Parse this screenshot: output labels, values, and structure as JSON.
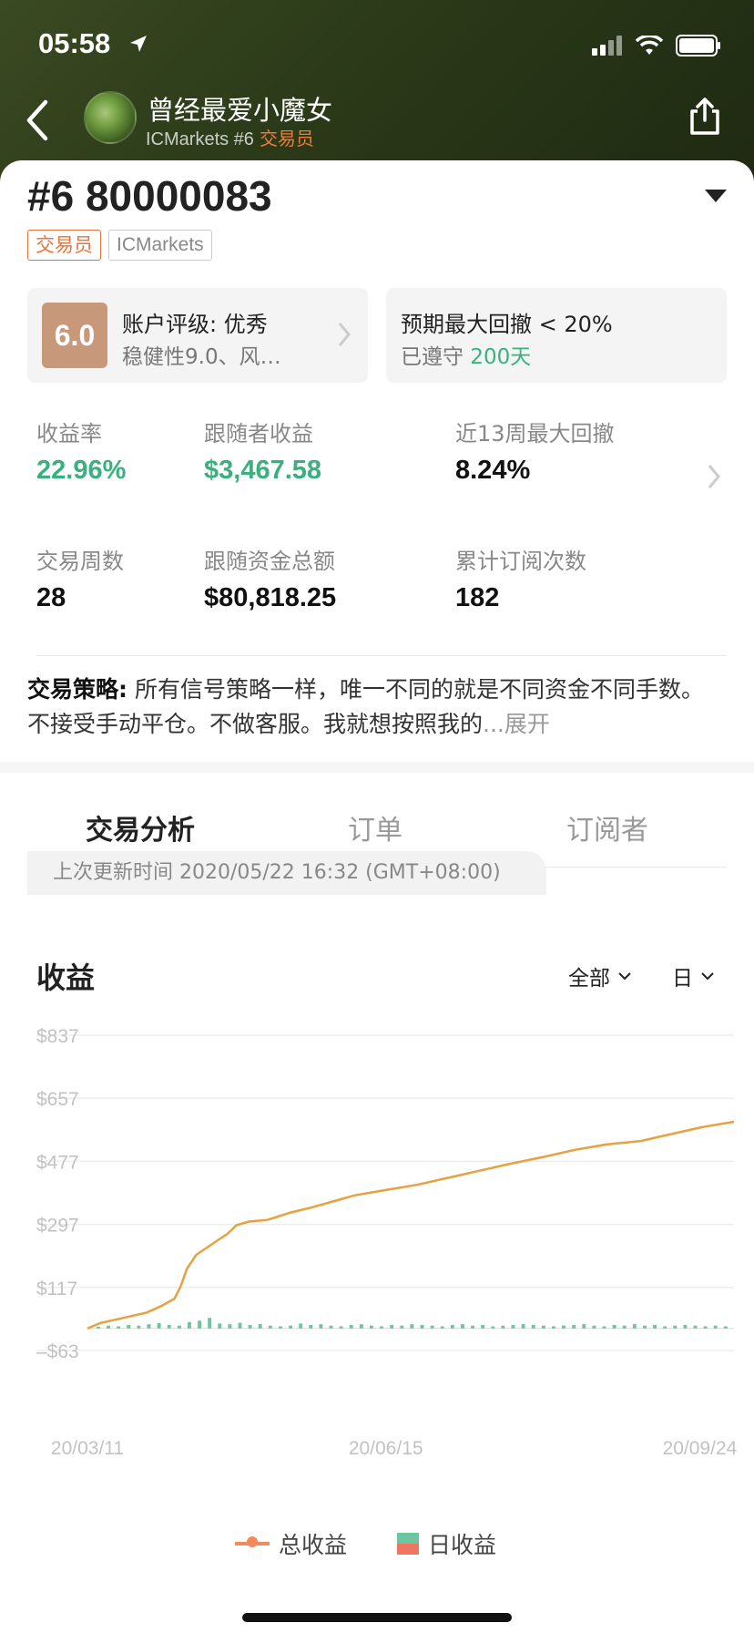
{
  "status_bar": {
    "time": "05:58"
  },
  "nav": {
    "nickname": "曾经最爱小魔女",
    "broker_rank": "ICMarkets #6",
    "role": "交易员"
  },
  "account": {
    "title": "#6 80000083",
    "tags": [
      "交易员",
      "ICMarkets"
    ]
  },
  "rating_box": {
    "score": "6.0",
    "title": "账户评级: 优秀",
    "subtitle": "稳健性9.0、风…"
  },
  "drawdown_box": {
    "title": "预期最大回撤 < 20%",
    "prefix": "已遵守",
    "days": "200天"
  },
  "stats": {
    "return_label": "收益率",
    "return_value": "22.96%",
    "follower_profit_label": "跟随者收益",
    "follower_profit_value": "$3,467.58",
    "max_drawdown_label": "近13周最大回撤",
    "max_drawdown_value": "8.24%",
    "weeks_label": "交易周数",
    "weeks_value": "28",
    "funds_label": "跟随资金总额",
    "funds_value": "$80,818.25",
    "subs_label": "累计订阅次数",
    "subs_value": "182"
  },
  "strategy": {
    "label": "交易策略:",
    "text": " 所有信号策略一样，唯一不同的就是不同资金不同手数。 不接受手动平仓。不做客服。我就想按照我的",
    "more": "...展开"
  },
  "tabs": [
    "交易分析",
    "订单",
    "订阅者"
  ],
  "updated": "上次更新时间 2020/05/22 16:32 (GMT+08:00)",
  "chart_header": {
    "title": "收益",
    "filter_all": "全部",
    "filter_day": "日"
  },
  "colors": {
    "accent": "#e8743b",
    "green": "#3bb07e",
    "line": "#e8a040",
    "bar": "#6cc4a0"
  },
  "chart_data": {
    "type": "line",
    "ylim": [
      -63,
      837
    ],
    "yticks": [
      "$837",
      "$657",
      "$477",
      "$297",
      "$117",
      "–$63"
    ],
    "ytick_values": [
      837,
      657,
      477,
      297,
      117,
      -63
    ],
    "xticks": [
      "20/03/11",
      "20/06/15",
      "20/09/24"
    ],
    "xtick_values": [
      "2020-03-11",
      "2020-06-15",
      "2020-09-24"
    ],
    "series": [
      {
        "name": "总收益",
        "x": [
          "2020-03-11",
          "2020-03-15",
          "2020-03-20",
          "2020-03-25",
          "2020-03-30",
          "2020-04-04",
          "2020-04-08",
          "2020-04-10",
          "2020-04-12",
          "2020-04-15",
          "2020-04-20",
          "2020-04-25",
          "2020-04-28",
          "2020-05-02",
          "2020-05-08",
          "2020-05-15",
          "2020-05-22",
          "2020-05-30",
          "2020-06-05",
          "2020-06-15",
          "2020-06-25",
          "2020-07-05",
          "2020-07-15",
          "2020-07-25",
          "2020-08-05",
          "2020-08-15",
          "2020-08-25",
          "2020-09-05",
          "2020-09-15",
          "2020-09-25",
          "2020-10-05"
        ],
        "values": [
          0,
          15,
          25,
          35,
          45,
          65,
          85,
          120,
          170,
          210,
          240,
          270,
          295,
          305,
          310,
          330,
          345,
          365,
          380,
          395,
          410,
          430,
          450,
          470,
          490,
          510,
          525,
          535,
          555,
          575,
          590
        ]
      },
      {
        "name": "日收益",
        "type": "bar",
        "values": [
          5,
          8,
          6,
          10,
          8,
          12,
          15,
          10,
          8,
          18,
          22,
          30,
          14,
          12,
          16,
          10,
          12,
          8,
          6,
          8,
          14,
          10,
          12,
          8,
          6,
          10,
          12,
          8,
          6,
          10,
          8,
          12,
          10,
          8,
          6,
          10,
          12,
          8,
          10,
          6,
          8,
          10,
          12,
          10,
          8,
          6,
          8,
          10,
          12,
          8,
          6,
          10,
          8,
          12,
          8,
          10,
          6,
          8,
          10,
          8,
          6,
          8,
          6
        ]
      }
    ]
  },
  "legend": {
    "total": "总收益",
    "daily": "日收益"
  }
}
